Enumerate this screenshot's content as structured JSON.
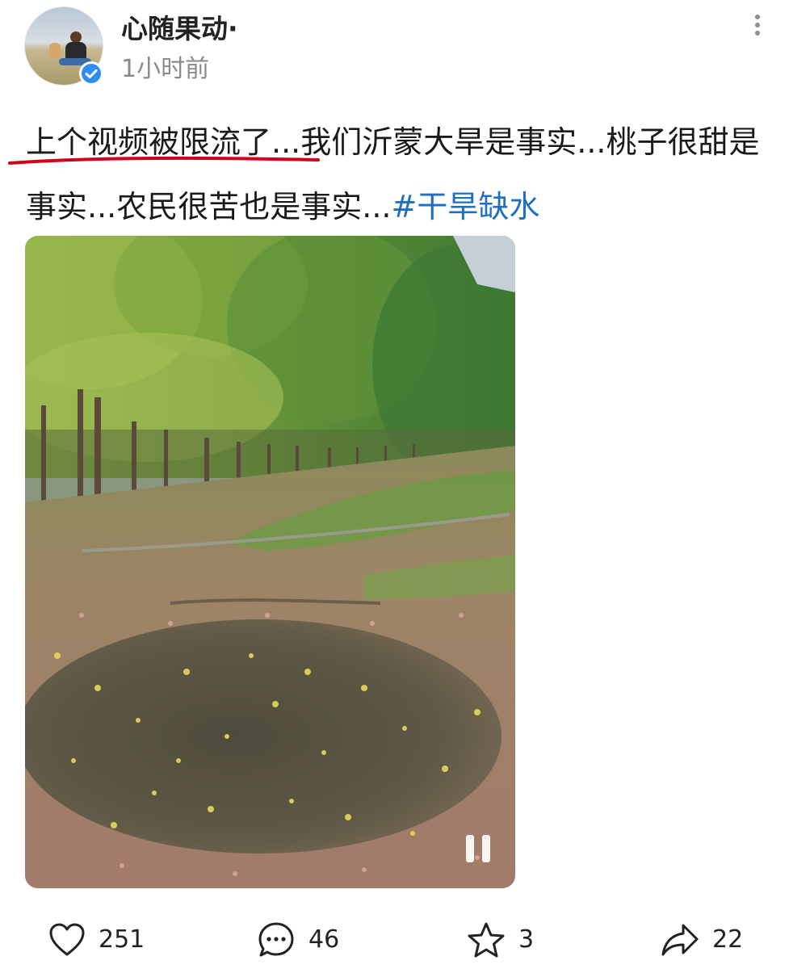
{
  "post": {
    "username": "心随果动·",
    "time": "1小时前",
    "text_part1": "上个视频被限流了...我们沂蒙大旱是事实...桃子很甜是事实...农民很苦也是事实...",
    "hashtag": "#干旱缺水",
    "verified_icon": "verified-check-icon",
    "more_icon": "more-vertical-icon",
    "annotation_color": "#d0021b"
  },
  "video": {
    "state": "playing",
    "control_icon": "pause-icon"
  },
  "actions": {
    "like_count": "251",
    "comment_count": "46",
    "favorite_count": "3",
    "share_count": "22"
  },
  "colors": {
    "hashtag": "#1f6fc2",
    "verified_badge": "#2f8ff0",
    "meta_text": "#8a8a8a"
  }
}
